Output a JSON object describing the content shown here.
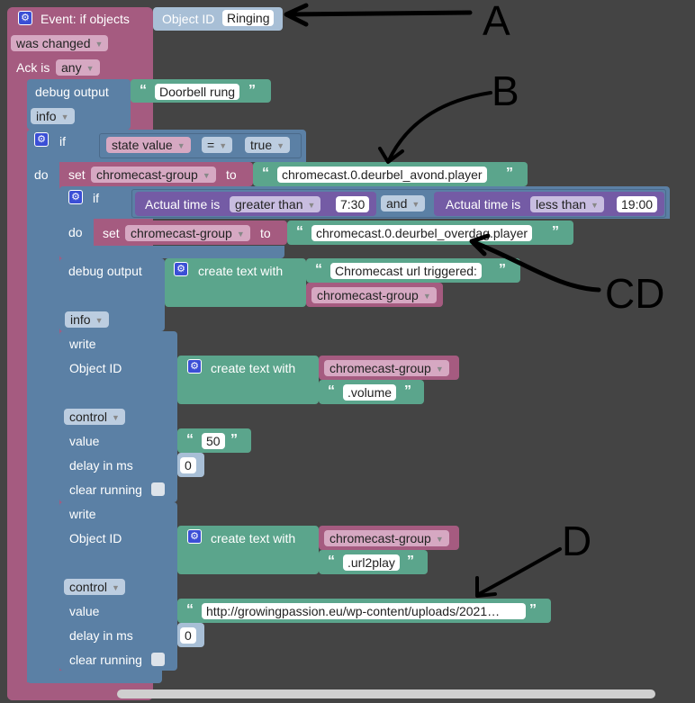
{
  "event": {
    "title": "Event: if objects",
    "object_id_label": "Object ID",
    "object_id_value": "Ringing",
    "was_changed": "was changed",
    "ack_label": "Ack is",
    "ack_value": "any"
  },
  "debug1": {
    "label": "debug output",
    "text": "Doorbell rung",
    "level": "info"
  },
  "if_block": {
    "if_label": "if",
    "do_label": "do",
    "state_value": "state value",
    "op": "=",
    "value": "true"
  },
  "set1": {
    "set_label": "set",
    "var": "chromecast-group",
    "to_label": "to",
    "value": "chromecast.0.deurbel_avond.player"
  },
  "if2": {
    "if_label": "if",
    "do_label": "do",
    "time1_label": "Actual time is",
    "time1_op": "greater than",
    "time1_value": "7:30",
    "and_label": "and",
    "time2_label": "Actual time is",
    "time2_op": "less than",
    "time2_value": "19:00"
  },
  "set2": {
    "set_label": "set",
    "var": "chromecast-group",
    "to_label": "to",
    "value": "chromecast.0.deurbel_overdag.player"
  },
  "debug2": {
    "label": "debug output",
    "create_text": "create text with",
    "text": "Chromecast url triggered:",
    "var": "chromecast-group",
    "level": "info"
  },
  "write1": {
    "write_label": "write",
    "object_id_label": "Object ID",
    "create_text": "create text with",
    "var": "chromecast-group",
    "suffix": ".volume",
    "control": "control",
    "value_label": "value",
    "value": "50",
    "delay_label": "delay in ms",
    "delay": "0",
    "clear_label": "clear running"
  },
  "write2": {
    "write_label": "write",
    "object_id_label": "Object ID",
    "create_text": "create text with",
    "var": "chromecast-group",
    "suffix": ".url2play",
    "control": "control",
    "value_label": "value",
    "value": "http://growingpassion.eu/wp-content/uploads/2021…",
    "delay_label": "delay in ms",
    "delay": "0",
    "clear_label": "clear running"
  },
  "annotations": {
    "a": "A",
    "b": "B",
    "cd": "CD",
    "d": "D"
  },
  "quote_open": "“",
  "quote_close": "”",
  "colors": {
    "workspace": "#444444",
    "event": "#a55b80",
    "logic": "#5b80a5",
    "text": "#5ba58c",
    "time": "#745ba5"
  }
}
